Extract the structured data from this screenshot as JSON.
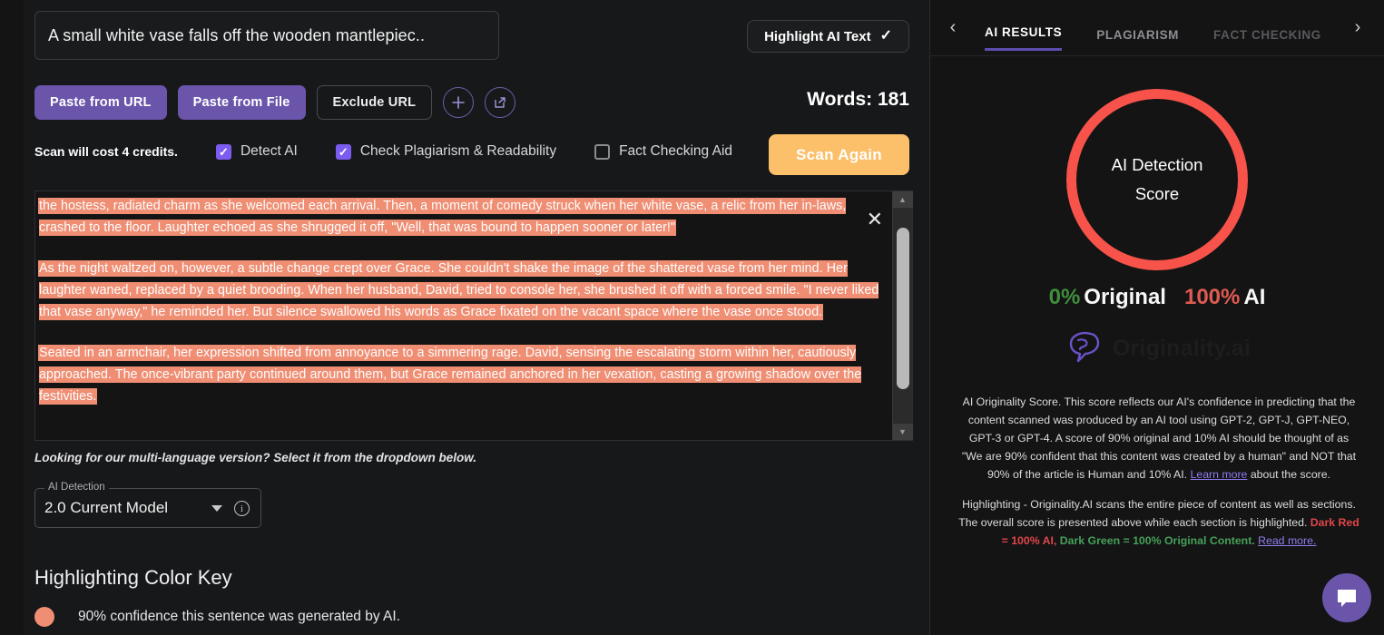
{
  "document": {
    "title": "A small white vase falls off the wooden mantlepiec..",
    "word_count_label": "Words: 181"
  },
  "toolbar": {
    "highlight_ai_text": "Highlight AI Text",
    "paste_from_url": "Paste from URL",
    "paste_from_file": "Paste from File",
    "exclude_url": "Exclude URL",
    "add_icon": "plus-icon",
    "share_icon": "external-link-icon"
  },
  "options": {
    "cost_note": "Scan will cost 4 credits.",
    "items": [
      {
        "label": "Detect AI",
        "checked": true
      },
      {
        "label": "Check Plagiarism & Readability",
        "checked": true
      },
      {
        "label": "Fact Checking Aid",
        "checked": false
      }
    ],
    "scan_button": "Scan Again"
  },
  "content": {
    "paragraphs": [
      "the hostess, radiated charm as she welcomed each arrival. Then, a moment of comedy struck when her white vase, a relic from her in-laws, crashed to the floor. Laughter echoed as she shrugged it off, \"Well, that was bound to happen sooner or later!\"",
      "As the night waltzed on, however, a subtle change crept over Grace. She couldn't shake the image of the shattered vase from her mind. Her laughter waned, replaced by a quiet brooding. When her husband, David, tried to console her, she brushed it off with a forced smile. \"I never liked that vase anyway,\" he reminded her. But silence swallowed his words as Grace fixated on the vacant space where the vase once stood.",
      "Seated in an armchair, her expression shifted from annoyance to a simmering rage. David, sensing the escalating storm within her, cautiously approached. The once-vibrant party continued around them, but Grace remained anchored in her vexation, casting a growing shadow over the festivities."
    ],
    "close_icon": "close-icon",
    "highlight_color": "#ef8e73"
  },
  "language_note": "Looking for our multi-language version? Select it from the dropdown below.",
  "model_select": {
    "legend": "AI Detection",
    "value": "2.0 Current Model",
    "caret_icon": "chevron-down-icon",
    "info_icon": "info-icon",
    "info_glyph": "i"
  },
  "color_key": {
    "heading": "Highlighting Color Key",
    "entries": [
      {
        "color": "#ef8e73",
        "label": "90% confidence this sentence was generated by AI."
      }
    ]
  },
  "results_panel": {
    "prev_icon": "chevron-left-icon",
    "next_icon": "chevron-right-icon",
    "tabs": [
      {
        "label": "AI RESULTS",
        "state": "active"
      },
      {
        "label": "PLAGIARISM",
        "state": "inactive"
      },
      {
        "label": "FACT CHECKING",
        "state": "disabled"
      }
    ],
    "gauge": {
      "line1": "AI Detection",
      "line2": "Score",
      "ring_color": "#f7534a"
    },
    "scores": {
      "original_pct": "0%",
      "original_label": "Original",
      "ai_pct": "100%",
      "ai_label": "AI",
      "original_color": "#3e8f3e",
      "ai_color": "#e05b52"
    },
    "brand": {
      "name": "Originality.ai",
      "icon": "brain-logo-icon"
    },
    "description_1": {
      "before_link": "AI Originality Score. This score reflects our AI's confidence in predicting that the content scanned was produced by an AI tool using GPT-2, GPT-J, GPT-NEO, GPT-3 or GPT-4. A score of 90% original and 10% AI should be thought of as \"We are 90% confident that this content was created by a human\" and NOT that 90% of the article is Human and 10% AI. ",
      "link": "Learn more",
      "after_link": " about the score."
    },
    "description_2": {
      "part1": "Highlighting - Originality.AI scans the entire piece of content as well as sections. The overall score is presented above while each section is highlighted. ",
      "red": "Dark Red = 100% AI",
      "comma": ", ",
      "green": "Dark Green = 100% Original Content.",
      "link": "Read more."
    }
  },
  "chat_widget": {
    "icon": "chat-bubble-icon"
  }
}
